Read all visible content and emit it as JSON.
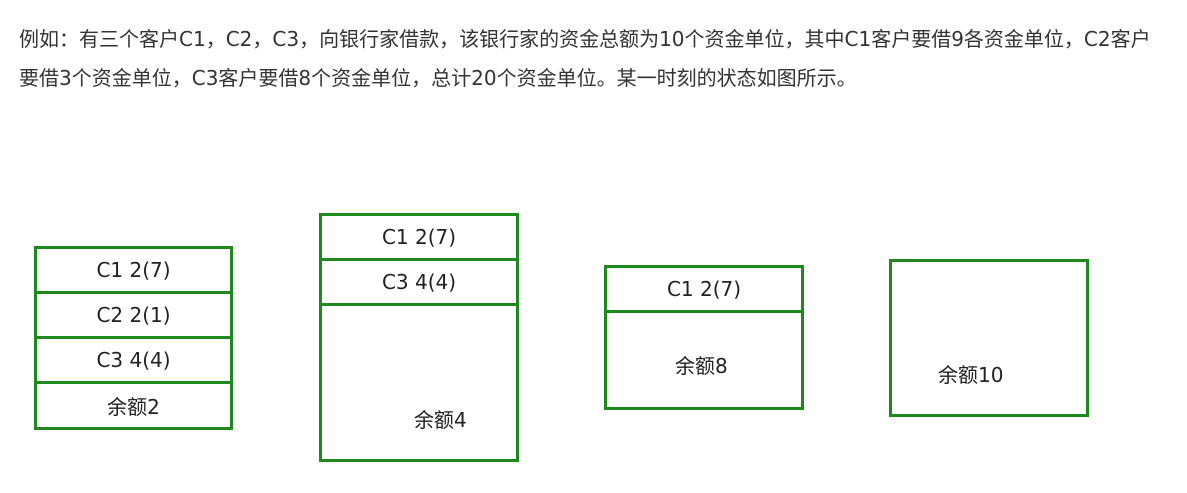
{
  "intro_text": "例如：有三个客户C1，C2，C3，向银行家借款，该银行家的资金总额为10个资金单位，其中C1客户要借9各资金单位，C2客户要借3个资金单位，C3客户要借8个资金单位，总计20个资金单位。某一时刻的状态如图所示。",
  "states": [
    {
      "rows": [
        "C1 2(7)",
        "C2 2(1)",
        "C3 4(4)"
      ],
      "remaining": "余额2"
    },
    {
      "rows": [
        "C1 2(7)",
        "C3 4(4)"
      ],
      "remaining": "余额4"
    },
    {
      "rows": [
        "C1 2(7)"
      ],
      "remaining": "余额8"
    },
    {
      "rows": [],
      "remaining": "余额10"
    }
  ],
  "colors": {
    "border": "#1e8a1e",
    "text": "#333333"
  }
}
